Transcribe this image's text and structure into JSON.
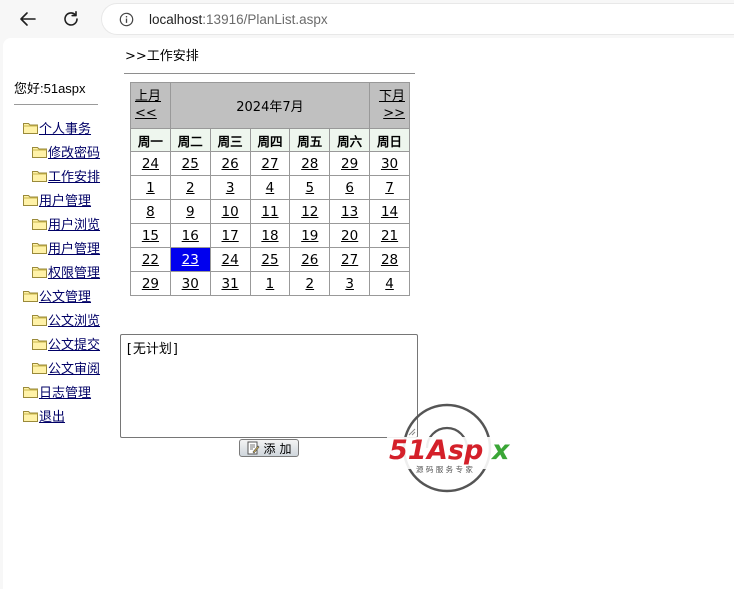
{
  "browser": {
    "url_host": "localhost",
    "url_rest": ":13916/PlanList.aspx"
  },
  "sidebar": {
    "greeting": "您好:51aspx",
    "items": [
      {
        "label": "个人事务",
        "level": 0
      },
      {
        "label": "修改密码",
        "level": 1
      },
      {
        "label": "工作安排",
        "level": 1
      },
      {
        "label": "用户管理",
        "level": 0
      },
      {
        "label": "用户浏览",
        "level": 1
      },
      {
        "label": "用户管理",
        "level": 1
      },
      {
        "label": "权限管理",
        "level": 1
      },
      {
        "label": "公文管理",
        "level": 0
      },
      {
        "label": "公文浏览",
        "level": 1
      },
      {
        "label": "公文提交",
        "level": 1
      },
      {
        "label": "公文审阅",
        "level": 1
      },
      {
        "label": "日志管理",
        "level": 0
      },
      {
        "label": "退出",
        "level": 0
      }
    ]
  },
  "main": {
    "section_title": ">>工作安排",
    "calendar": {
      "prev_text": "上月",
      "prev_arrows": "<<",
      "title": "2024年7月",
      "next_text": "下月",
      "next_arrows": ">>",
      "weekdays": [
        "周一",
        "周二",
        "周三",
        "周四",
        "周五",
        "周六",
        "周日"
      ],
      "weeks": [
        [
          "24",
          "25",
          "26",
          "27",
          "28",
          "29",
          "30"
        ],
        [
          "1",
          "2",
          "3",
          "4",
          "5",
          "6",
          "7"
        ],
        [
          "8",
          "9",
          "10",
          "11",
          "12",
          "13",
          "14"
        ],
        [
          "15",
          "16",
          "17",
          "18",
          "19",
          "20",
          "21"
        ],
        [
          "22",
          "23",
          "24",
          "25",
          "26",
          "27",
          "28"
        ],
        [
          "29",
          "30",
          "31",
          "1",
          "2",
          "3",
          "4"
        ]
      ],
      "selected": {
        "week": 4,
        "day": 1
      },
      "selected_color": "#0000ee"
    },
    "plan_text": "[无计划]",
    "add_button": "添加"
  },
  "watermark": {
    "brand": "51Aspx",
    "tagline": "源码服务专家",
    "colors": {
      "red": "#d4202a",
      "green": "#3aa636",
      "gray": "#555555"
    }
  }
}
